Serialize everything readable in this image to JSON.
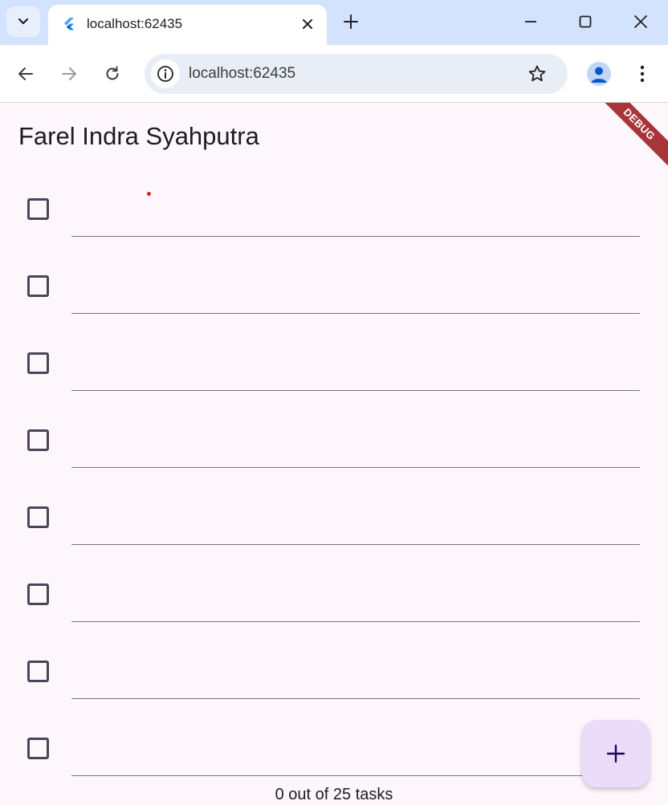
{
  "browser": {
    "tab_title": "localhost:62435",
    "url": "localhost:62435"
  },
  "icons": {
    "tab_list": "chevron-down-icon",
    "favicon": "flutter-icon",
    "close": "close-icon",
    "new_tab": "plus-icon",
    "back": "arrow-left-icon",
    "forward": "arrow-right-icon",
    "reload": "reload-icon",
    "site_info": "info-icon",
    "bookmark": "star-icon",
    "profile": "person-icon",
    "menu": "kebab-menu-icon",
    "fab": "plus-icon"
  },
  "app": {
    "title": "Farel Indra Syahputra",
    "debug_banner": "DEBUG",
    "tasks": [
      {
        "done": false,
        "text": ""
      },
      {
        "done": false,
        "text": ""
      },
      {
        "done": false,
        "text": ""
      },
      {
        "done": false,
        "text": ""
      },
      {
        "done": false,
        "text": ""
      },
      {
        "done": false,
        "text": ""
      },
      {
        "done": false,
        "text": ""
      },
      {
        "done": false,
        "text": ""
      }
    ],
    "footer": "0 out of 25 tasks"
  },
  "colors": {
    "app_background": "#fdf7fc",
    "fab_background": "#ebdcfa",
    "debug_banner": "#a8353a",
    "tabstrip": "#d3e3fd"
  }
}
